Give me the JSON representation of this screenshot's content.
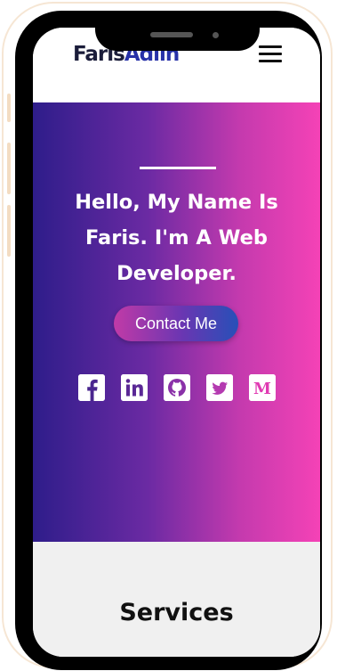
{
  "navbar": {
    "logo_first": "Faris",
    "logo_last": "Adlin",
    "menu_icon": "hamburger-menu-icon"
  },
  "hero": {
    "title": "Hello, My Name Is Faris. I'm A Web Developer.",
    "contact_button": "Contact Me",
    "social_icons": [
      "facebook-icon",
      "linkedin-icon",
      "github-icon",
      "twitter-icon",
      "medium-icon"
    ],
    "medium_letter": "M",
    "gradient_colors": [
      "#2e1d8a",
      "#f542b6"
    ]
  },
  "services": {
    "title": "Services"
  },
  "colors": {
    "logo_dark": "#1b1d3a",
    "logo_accent": "#2731a8",
    "services_bg": "#f0f0f0"
  }
}
